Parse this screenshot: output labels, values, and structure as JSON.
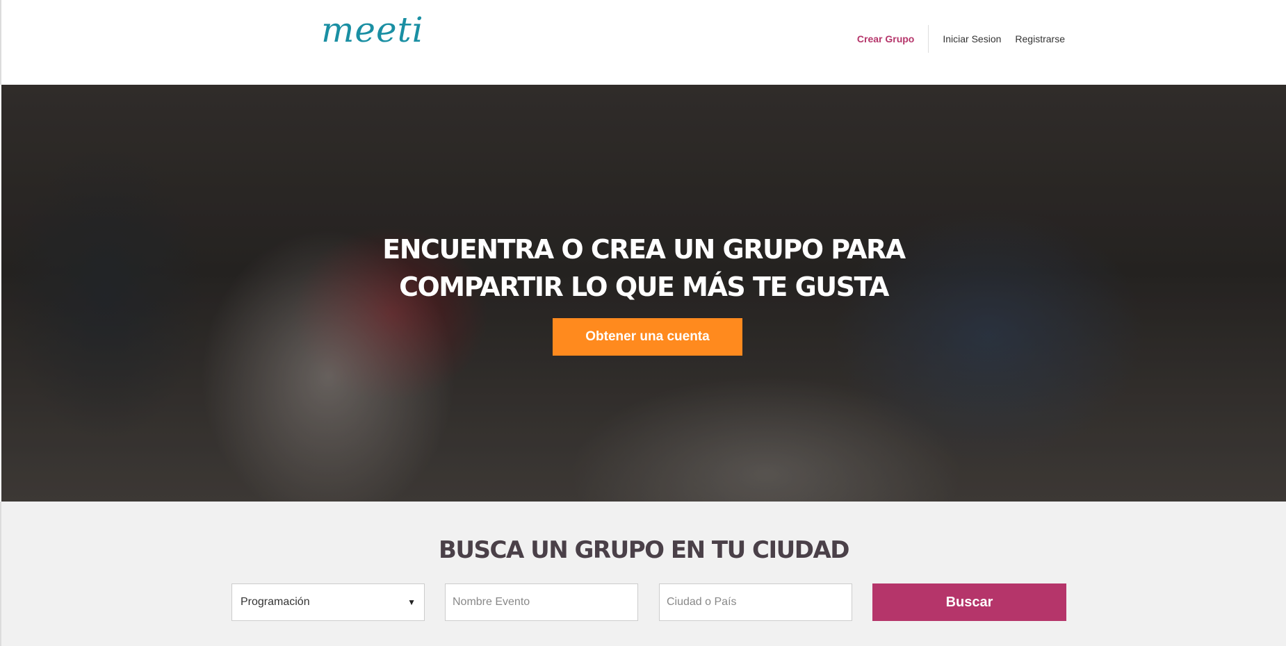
{
  "header": {
    "logo": "meeti",
    "nav": {
      "crear_grupo": "Crear Grupo",
      "iniciar_sesion": "Iniciar Sesion",
      "registrarse": "Registrarse"
    }
  },
  "hero": {
    "title_line1": "Encuentra o crea un grupo para",
    "title_line2": "compartir lo que más te gusta",
    "cta": "Obtener una cuenta"
  },
  "search": {
    "title": "Busca un grupo en tu ciudad",
    "category_selected": "Programación",
    "event_placeholder": "Nombre Evento",
    "city_placeholder": "Ciudad o País",
    "button": "Buscar"
  },
  "colors": {
    "brand": "#1a8fa3",
    "accent": "#b5356a",
    "cta": "#ff8a1e"
  }
}
